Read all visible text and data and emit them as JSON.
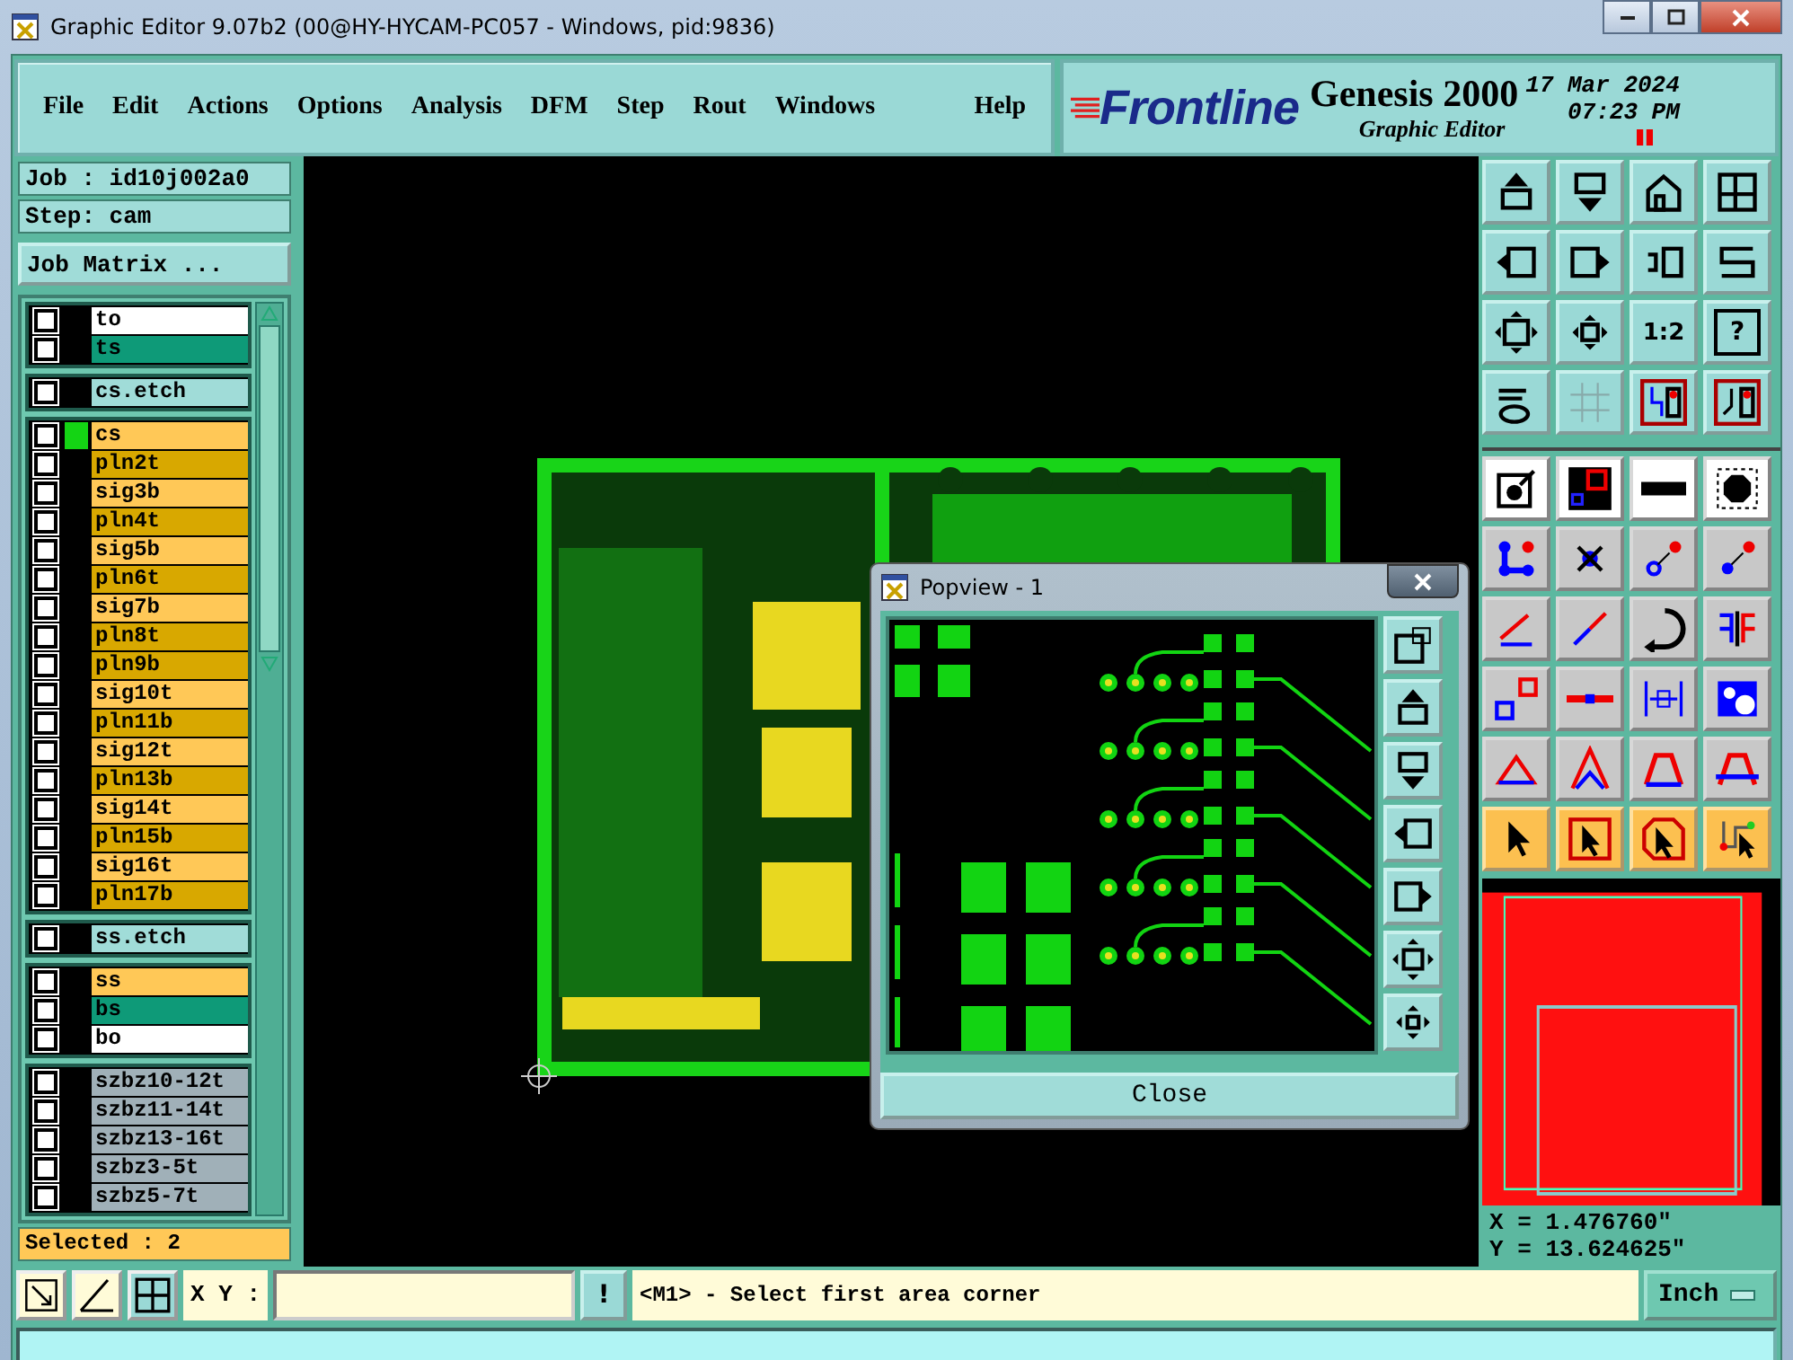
{
  "window": {
    "title": "Graphic Editor 9.07b2 (00@HY-HYCAM-PC057 - Windows, pid:9836)"
  },
  "menu": [
    "File",
    "Edit",
    "Actions",
    "Options",
    "Analysis",
    "DFM",
    "Step",
    "Rout",
    "Windows",
    "Help"
  ],
  "brand": {
    "logo": "Frontline",
    "product": "Genesis 2000",
    "subtitle": "Graphic Editor",
    "date": "17 Mar 2024",
    "time": "07:23 PM"
  },
  "job": {
    "job": "Job : id10j002a0",
    "step": "Step: cam",
    "matrix_button": "Job Matrix ..."
  },
  "layer_groups": [
    {
      "layers": [
        {
          "name": "to",
          "color": "#ffffff",
          "checked": false,
          "work": false
        },
        {
          "name": "ts",
          "color": "#0e9a78",
          "checked": false,
          "work": false
        }
      ]
    },
    {
      "layers": [
        {
          "name": "cs.etch",
          "color": "#a0dcd8",
          "checked": false,
          "work": false
        }
      ]
    },
    {
      "layers": [
        {
          "name": "cs",
          "color": "#ffc857",
          "checked": false,
          "work": true
        },
        {
          "name": "pln2t",
          "color": "#d8a800",
          "checked": false,
          "work": false
        },
        {
          "name": "sig3b",
          "color": "#ffc857",
          "checked": false,
          "work": false
        },
        {
          "name": "pln4t",
          "color": "#d8a800",
          "checked": false,
          "work": false
        },
        {
          "name": "sig5b",
          "color": "#ffc857",
          "checked": false,
          "work": false
        },
        {
          "name": "pln6t",
          "color": "#d8a800",
          "checked": false,
          "work": false
        },
        {
          "name": "sig7b",
          "color": "#ffc857",
          "checked": false,
          "work": false
        },
        {
          "name": "pln8t",
          "color": "#d8a800",
          "checked": false,
          "work": false
        },
        {
          "name": "pln9b",
          "color": "#d8a800",
          "checked": false,
          "work": false
        },
        {
          "name": "sig10t",
          "color": "#ffc857",
          "checked": false,
          "work": false
        },
        {
          "name": "pln11b",
          "color": "#d8a800",
          "checked": false,
          "work": false
        },
        {
          "name": "sig12t",
          "color": "#ffc857",
          "checked": false,
          "work": false
        },
        {
          "name": "pln13b",
          "color": "#d8a800",
          "checked": false,
          "work": false
        },
        {
          "name": "sig14t",
          "color": "#ffc857",
          "checked": false,
          "work": false
        },
        {
          "name": "pln15b",
          "color": "#d8a800",
          "checked": false,
          "work": false
        },
        {
          "name": "sig16t",
          "color": "#ffc857",
          "checked": false,
          "work": false
        },
        {
          "name": "pln17b",
          "color": "#d8a800",
          "checked": false,
          "work": false
        }
      ]
    },
    {
      "layers": [
        {
          "name": "ss.etch",
          "color": "#a0dcd8",
          "checked": false,
          "work": false
        }
      ]
    },
    {
      "layers": [
        {
          "name": "ss",
          "color": "#ffc857",
          "checked": false,
          "work": false
        },
        {
          "name": "bs",
          "color": "#0e9a78",
          "checked": false,
          "work": false
        },
        {
          "name": "bo",
          "color": "#ffffff",
          "checked": false,
          "work": false
        }
      ]
    },
    {
      "layers": [
        {
          "name": "szbz10-12t",
          "color": "#a0b0b8",
          "checked": false,
          "work": false
        },
        {
          "name": "szbz11-14t",
          "color": "#a0b0b8",
          "checked": false,
          "work": false
        },
        {
          "name": "szbz13-16t",
          "color": "#a0b0b8",
          "checked": false,
          "work": false
        },
        {
          "name": "szbz3-5t",
          "color": "#a0b0b8",
          "checked": false,
          "work": false
        },
        {
          "name": "szbz5-7t",
          "color": "#a0b0b8",
          "checked": false,
          "work": false
        }
      ]
    }
  ],
  "selected_count": "Selected : 2",
  "popview": {
    "title": "Popview - 1",
    "close_button": "Close"
  },
  "toolbar": {
    "ratio_label": "1:2",
    "help_label": "?"
  },
  "coordinates": {
    "x": "X = 1.476760\"",
    "y": "Y = 13.624625\""
  },
  "command_line": {
    "label": "X Y :",
    "bang": "!",
    "message": "<M1> - Select first area corner",
    "units": "Inch"
  }
}
